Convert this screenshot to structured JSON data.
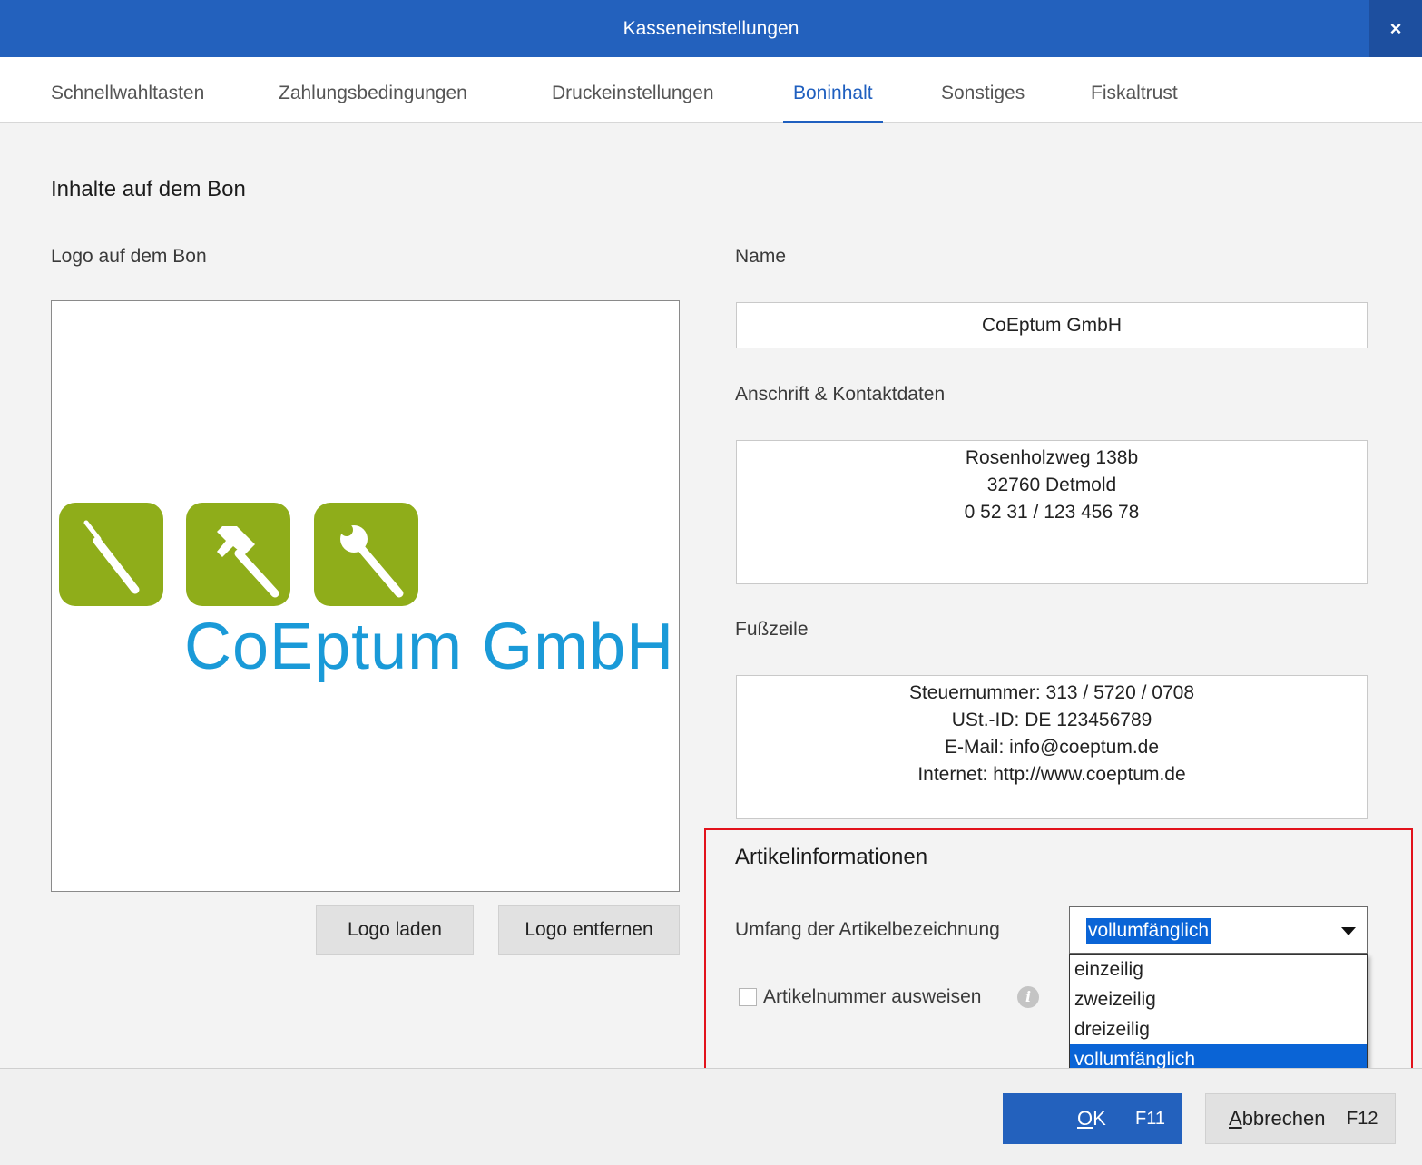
{
  "window": {
    "title": "Kasseneinstellungen",
    "close_label": "×"
  },
  "tabs": [
    {
      "label": "Schnellwahltasten"
    },
    {
      "label": "Zahlungsbedingungen"
    },
    {
      "label": "Druckeinstellungen"
    },
    {
      "label": "Boninhalt",
      "active": true
    },
    {
      "label": "Sonstiges"
    },
    {
      "label": "Fiskaltrust"
    }
  ],
  "section": {
    "title": "Inhalte auf dem Bon"
  },
  "logo": {
    "label": "Logo auf dem Bon",
    "image_text": "CoEptum GmbH",
    "tile_color": "#8fad1a",
    "text_color": "#1a9ad8",
    "icons": [
      "screwdriver-icon",
      "hammer-icon",
      "wrench-icon"
    ],
    "load_button": "Logo laden",
    "remove_button": "Logo entfernen"
  },
  "name": {
    "label": "Name",
    "value": "CoEptum GmbH"
  },
  "address": {
    "label": "Anschrift & Kontaktdaten",
    "lines": [
      "Rosenholzweg 138b",
      "32760 Detmold",
      "0 52 31 / 123 456 78"
    ]
  },
  "footer_text": {
    "label": "Fußzeile",
    "lines": [
      "Steuernummer: 313 / 5720 / 0708",
      "USt.-ID: DE 123456789",
      "E-Mail: info@coeptum.de",
      "Internet: http://www.coeptum.de"
    ]
  },
  "article_info": {
    "title": "Artikelinformationen",
    "scope_label": "Umfang der Artikelbezeichnung",
    "scope_selected": "vollumfänglich",
    "scope_options": [
      "einzeilig",
      "zweizeilig",
      "dreizeilig",
      "vollumfänglich"
    ],
    "article_number_label": "Artikelnummer ausweisen",
    "article_number_checked": false,
    "highlight_color": "#e2121b"
  },
  "buttons": {
    "ok_mnemonic": "O",
    "ok_rest": "K",
    "ok_key": "F11",
    "cancel_mnemonic": "A",
    "cancel_rest": "bbrechen",
    "cancel_key": "F12"
  },
  "colors": {
    "accent": "#2361bd",
    "selection": "#0a64d6"
  }
}
